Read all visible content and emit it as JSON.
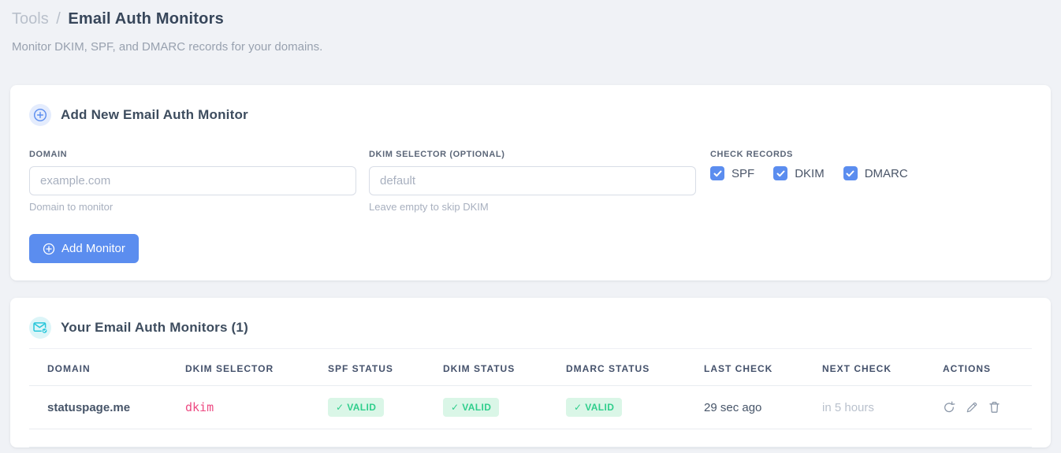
{
  "page": {
    "breadcrumb_root": "Tools",
    "breadcrumb_sep": "/",
    "title": "Email Auth Monitors",
    "subtitle": "Monitor DKIM, SPF, and DMARC records for your domains."
  },
  "add_card": {
    "title": "Add New Email Auth Monitor",
    "domain_label": "DOMAIN",
    "domain_placeholder": "example.com",
    "domain_help": "Domain to monitor",
    "selector_label": "DKIM SELECTOR (OPTIONAL)",
    "selector_placeholder": "default",
    "selector_help": "Leave empty to skip DKIM",
    "records_label": "CHECK RECORDS",
    "records": [
      {
        "label": "SPF",
        "checked": true
      },
      {
        "label": "DKIM",
        "checked": true
      },
      {
        "label": "DMARC",
        "checked": true
      }
    ],
    "submit_label": "Add Monitor"
  },
  "monitors_card": {
    "title": "Your Email Auth Monitors (1)",
    "columns": [
      "DOMAIN",
      "DKIM SELECTOR",
      "SPF STATUS",
      "DKIM STATUS",
      "DMARC STATUS",
      "LAST CHECK",
      "NEXT CHECK",
      "ACTIONS"
    ],
    "rows": [
      {
        "domain": "statuspage.me",
        "dkim_selector": "dkim",
        "spf_status": "✓ VALID",
        "dkim_status": "✓ VALID",
        "dmarc_status": "✓ VALID",
        "last_check": "29 sec ago",
        "next_check": "in 5 hours"
      }
    ]
  },
  "colors": {
    "accent_blue": "#5b8def",
    "icon_cyan": "#26c6da",
    "badge_green_bg": "#daf6e7",
    "badge_green_text": "#2fce8c",
    "selector_pink": "#ed4a82"
  }
}
